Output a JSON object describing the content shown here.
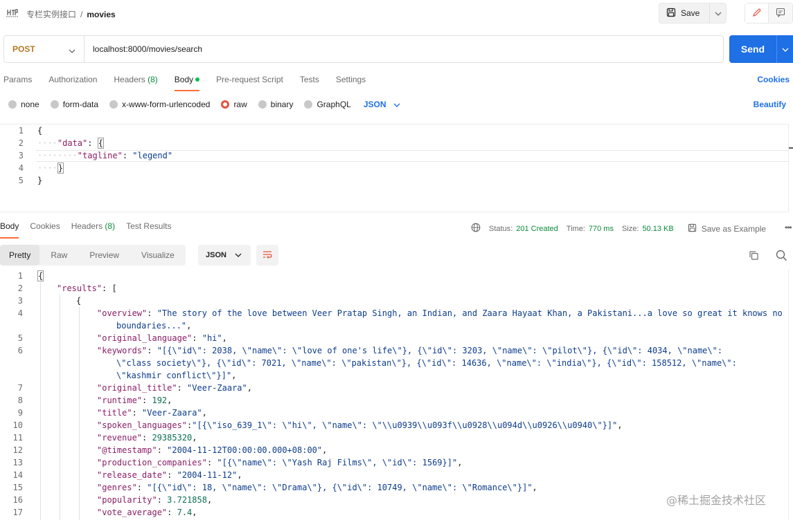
{
  "topbar": {
    "app_icon": "http-icon",
    "breadcrumb_parent": "专栏实例接口",
    "breadcrumb_sep": "/",
    "breadcrumb_current": "movies",
    "save_label": "Save",
    "save_icon": "floppy-disk-icon",
    "edit_icon": "pencil-icon",
    "comment_icon": "comment-icon"
  },
  "request": {
    "method": "POST",
    "url": "localhost:8000/movies/search",
    "send_label": "Send"
  },
  "request_tabs": {
    "params": "Params",
    "authorization": "Authorization",
    "headers": "Headers",
    "headers_count": "(8)",
    "body": "Body",
    "pre_request": "Pre-request Script",
    "tests": "Tests",
    "settings": "Settings",
    "cookies": "Cookies"
  },
  "body_types": {
    "none": "none",
    "form_data": "form-data",
    "urlencoded": "x-www-form-urlencoded",
    "raw": "raw",
    "binary": "binary",
    "graphql": "GraphQL",
    "language": "JSON",
    "beautify": "Beautify"
  },
  "request_body": {
    "lines": [
      "1",
      "2",
      "3",
      "4",
      "5"
    ],
    "open": "{",
    "data_key": "\"data\"",
    "colon": ": ",
    "data_open": "{",
    "tagline_key": "\"tagline\"",
    "tagline_value": "\"legend\"",
    "data_close": "}",
    "close": "}"
  },
  "response_tabs": {
    "body": "Body",
    "cookies": "Cookies",
    "headers": "Headers",
    "headers_count": "(8)",
    "test_results": "Test Results"
  },
  "response_meta": {
    "status_label": "Status:",
    "status_value": "201 Created",
    "time_label": "Time:",
    "time_value": "770 ms",
    "size_label": "Size:",
    "size_value": "50.13 KB",
    "save_example": "Save as Example",
    "more": "•••"
  },
  "view_tabs": {
    "pretty": "Pretty",
    "raw": "Raw",
    "preview": "Preview",
    "visualize": "Visualize",
    "format": "JSON"
  },
  "response_body": {
    "l1": "{",
    "l2_key": "\"results\"",
    "l2_rest": ": [",
    "l3": "{",
    "l4_key": "\"overview\"",
    "l4_val": "\"The story of the love between Veer Pratap Singh, an Indian, and Zaara Hayaat Khan, a Pakistani...a love so great it knows no boundaries...\"",
    "l5_key": "\"original_language\"",
    "l5_val": "\"hi\"",
    "l6_key": "\"keywords\"",
    "l6_val": "\"[{\\\"id\\\": 2038, \\\"name\\\": \\\"love of one's life\\\"}, {\\\"id\\\": 3203, \\\"name\\\": \\\"pilot\\\"}, {\\\"id\\\": 4034, \\\"name\\\": \\\"class society\\\"}, {\\\"id\\\": 7021, \\\"name\\\": \\\"pakistan\\\"}, {\\\"id\\\": 14636, \\\"name\\\": \\\"india\\\"}, {\\\"id\\\": 158512, \\\"name\\\": \\\"kashmir conflict\\\"}]\"",
    "l7_key": "\"original_title\"",
    "l7_val": "\"Veer-Zaara\"",
    "l8_key": "\"runtime\"",
    "l8_val": "192",
    "l9_key": "\"title\"",
    "l9_val": "\"Veer-Zaara\"",
    "l10_key": "\"spoken_languages\"",
    "l10_val": "\"[{\\\"iso_639_1\\\": \\\"hi\\\", \\\"name\\\": \\\"\\\\u0939\\\\u093f\\\\u0928\\\\u094d\\\\u0926\\\\u0940\\\"}]\"",
    "l11_key": "\"revenue\"",
    "l11_val": "29385320",
    "l12_key": "\"@timestamp\"",
    "l12_val": "\"2004-11-12T00:00:00.000+08:00\"",
    "l13_key": "\"production_companies\"",
    "l13_val": "\"[{\\\"name\\\": \\\"Yash Raj Films\\\", \\\"id\\\": 1569}]\"",
    "l14_key": "\"release_date\"",
    "l14_val": "\"2004-11-12\"",
    "l15_key": "\"genres\"",
    "l15_val": "\"[{\\\"id\\\": 18, \\\"name\\\": \\\"Drama\\\"}, {\\\"id\\\": 10749, \\\"name\\\": \\\"Romance\\\"}]\"",
    "l16_key": "\"popularity\"",
    "l16_val": "3.721858",
    "l17_key": "\"vote_average\"",
    "l17_val": "7.4"
  },
  "line_numbers": [
    "1",
    "2",
    "3",
    "4",
    "5",
    "6",
    "7",
    "8",
    "9",
    "10",
    "11",
    "12",
    "13",
    "14",
    "15",
    "16",
    "17"
  ],
  "watermark": "@稀土掘金技术社区",
  "colors": {
    "accent": "#ff6c37",
    "send": "#1f6fe5",
    "status_ok": "#0b8a3a",
    "method_post": "#b7791f",
    "json_key": "#8a1d66",
    "json_string": "#0b3c8c"
  }
}
